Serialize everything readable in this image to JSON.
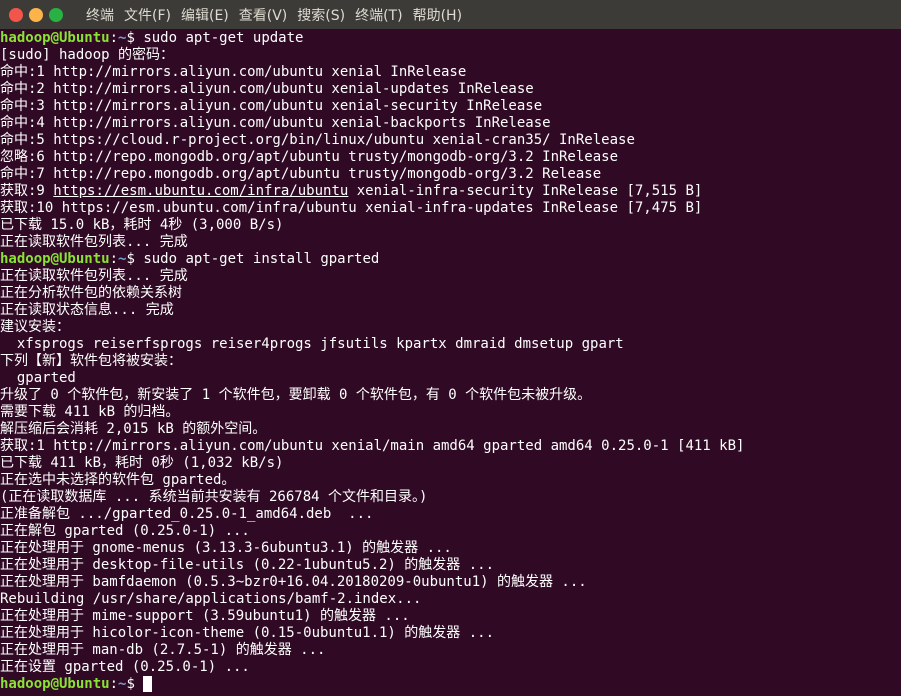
{
  "window": {
    "menu": [
      {
        "label": "终端"
      },
      {
        "label": "文件(F)"
      },
      {
        "label": "编辑(E)"
      },
      {
        "label": "查看(V)"
      },
      {
        "label": "搜索(S)"
      },
      {
        "label": "终端(T)"
      },
      {
        "label": "帮助(H)"
      }
    ]
  },
  "terminal": {
    "prompt_user": "hadoop@Ubuntu",
    "prompt_sep": ":",
    "prompt_path": "~",
    "prompt_end": "$ ",
    "commands": [
      "sudo apt-get update",
      "sudo apt-get install gparted"
    ],
    "update_output": [
      "[sudo] hadoop 的密码：",
      "命中:1 http://mirrors.aliyun.com/ubuntu xenial InRelease",
      "命中:2 http://mirrors.aliyun.com/ubuntu xenial-updates InRelease",
      "命中:3 http://mirrors.aliyun.com/ubuntu xenial-security InRelease",
      "命中:4 http://mirrors.aliyun.com/ubuntu xenial-backports InRelease",
      "命中:5 https://cloud.r-project.org/bin/linux/ubuntu xenial-cran35/ InRelease",
      "忽略:6 http://repo.mongodb.org/apt/ubuntu trusty/mongodb-org/3.2 InRelease",
      "命中:7 http://repo.mongodb.org/apt/ubuntu trusty/mongodb-org/3.2 Release"
    ],
    "link_line": {
      "prefix": "获取:9 ",
      "link": "https://esm.ubuntu.com/infra/ubuntu",
      "suffix": " xenial-infra-security InRelease [7,515 B]"
    },
    "update_output_2": [
      "获取:10 https://esm.ubuntu.com/infra/ubuntu xenial-infra-updates InRelease [7,475 B]",
      "已下载 15.0 kB，耗时 4秒 (3,000 B/s)",
      "正在读取软件包列表... 完成"
    ],
    "install_output": [
      "正在读取软件包列表... 完成",
      "正在分析软件包的依赖关系树",
      "正在读取状态信息... 完成",
      "建议安装：",
      "  xfsprogs reiserfsprogs reiser4progs jfsutils kpartx dmraid dmsetup gpart",
      "下列【新】软件包将被安装：",
      "  gparted",
      "升级了 0 个软件包，新安装了 1 个软件包，要卸载 0 个软件包，有 0 个软件包未被升级。",
      "需要下载 411 kB 的归档。",
      "解压缩后会消耗 2,015 kB 的额外空间。",
      "获取:1 http://mirrors.aliyun.com/ubuntu xenial/main amd64 gparted amd64 0.25.0-1 [411 kB]",
      "已下载 411 kB，耗时 0秒 (1,032 kB/s)",
      "正在选中未选择的软件包 gparted。",
      "(正在读取数据库 ... 系统当前共安装有 266784 个文件和目录。)",
      "正准备解包 .../gparted_0.25.0-1_amd64.deb  ...",
      "正在解包 gparted (0.25.0-1) ...",
      "正在处理用于 gnome-menus (3.13.3-6ubuntu3.1) 的触发器 ...",
      "正在处理用于 desktop-file-utils (0.22-1ubuntu5.2) 的触发器 ...",
      "正在处理用于 bamfdaemon (0.5.3~bzr0+16.04.20180209-0ubuntu1) 的触发器 ...",
      "Rebuilding /usr/share/applications/bamf-2.index...",
      "正在处理用于 mime-support (3.59ubuntu1) 的触发器 ...",
      "正在处理用于 hicolor-icon-theme (0.15-0ubuntu1.1) 的触发器 ...",
      "正在处理用于 man-db (2.7.5-1) 的触发器 ...",
      "正在设置 gparted (0.25.0-1) ..."
    ]
  },
  "colors": {
    "background": "#300a24",
    "titlebar": "#3c3b37",
    "prompt_user": "#8ae234",
    "prompt_path": "#729fcf"
  }
}
